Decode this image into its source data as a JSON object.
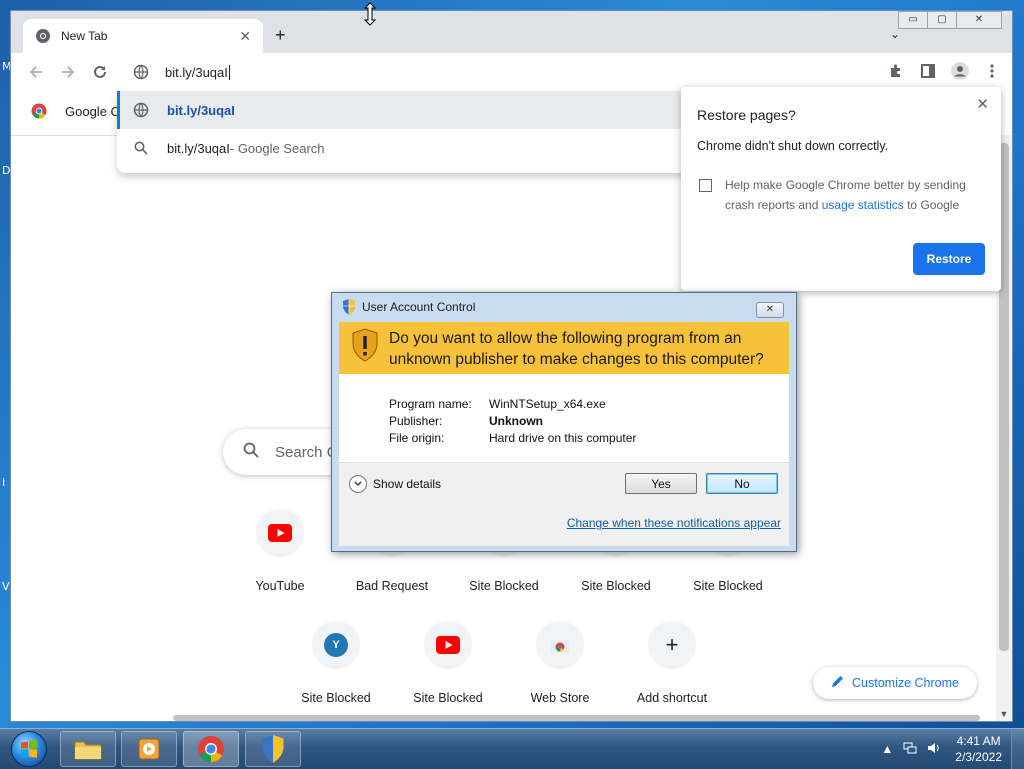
{
  "desktop": {
    "fragments": [
      "M",
      "D",
      "I",
      "V"
    ]
  },
  "browser": {
    "tab": {
      "title": "New Tab",
      "close": "✕"
    },
    "new_tab": "+",
    "tab_search": "⌄",
    "window_controls": {
      "minimize": "▭",
      "maximize": "▢",
      "close": "✕"
    },
    "omnibox": {
      "value": "bit.ly/3uqaI"
    },
    "bookmarks": [
      {
        "label": "Google C"
      }
    ],
    "suggestions": [
      {
        "text": "bit.ly/3uqaI",
        "type": "url"
      },
      {
        "text": "bit.ly/3uqaI",
        "suffix": " - Google Search",
        "type": "search"
      }
    ]
  },
  "restore_popup": {
    "title": "Restore pages?",
    "subtitle": "Chrome didn't shut down correctly.",
    "checkbox_text_1": "Help make Google Chrome better by sending crash reports and ",
    "checkbox_link": "usage statistics",
    "checkbox_text_2": " to Google",
    "button": "Restore",
    "close": "✕"
  },
  "ntp": {
    "search_placeholder": "Search G",
    "tiles_row1": [
      {
        "label": "YouTube",
        "icon": "youtube-icon"
      },
      {
        "label": "Bad Request",
        "icon": "generic-site-icon"
      },
      {
        "label": "Site Blocked",
        "icon": "generic-site-icon"
      },
      {
        "label": "Site Blocked",
        "icon": "generic-site-icon"
      },
      {
        "label": "Site Blocked",
        "icon": "generic-site-icon"
      }
    ],
    "tiles_row2": [
      {
        "label": "Site Blocked",
        "icon": "y-letter-icon",
        "letter": "Y"
      },
      {
        "label": "Site Blocked",
        "icon": "youtube-icon"
      },
      {
        "label": "Web Store",
        "icon": "web-store-icon"
      },
      {
        "label": "Add shortcut",
        "icon": "plus-icon",
        "glyph": "+"
      }
    ],
    "customize": "Customize Chrome"
  },
  "uac": {
    "title": "User Account Control",
    "close": "✕",
    "question": "Do you want to allow the following program from an unknown publisher to make changes to this computer?",
    "fields": [
      {
        "key": "Program name:",
        "value": "WinNTSetup_x64.exe",
        "bold": false
      },
      {
        "key": "Publisher:",
        "value": "Unknown",
        "bold": true
      },
      {
        "key": "File origin:",
        "value": "Hard drive on this computer",
        "bold": false
      }
    ],
    "show_details": "Show details",
    "yes": "Yes",
    "no": "No",
    "change_link": "Change when these notifications appear"
  },
  "taskbar": {
    "time": "4:41 AM",
    "date": "2/3/2022"
  }
}
